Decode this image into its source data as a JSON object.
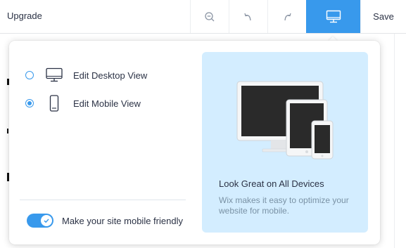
{
  "topbar": {
    "upgrade_label": "Upgrade",
    "zoom_out_icon": "zoom-out-icon",
    "undo_icon": "undo-icon",
    "redo_icon": "redo-icon",
    "device_icon": "desktop-icon",
    "save_label": "Save",
    "accent_color": "#3899ec"
  },
  "popover": {
    "options": [
      {
        "label": "Edit Desktop View",
        "icon": "desktop-icon",
        "selected": false
      },
      {
        "label": "Edit Mobile View",
        "icon": "mobile-icon",
        "selected": true
      }
    ],
    "toggle": {
      "label": "Make your site mobile friendly",
      "on": true
    },
    "panel": {
      "title": "Look Great on All Devices",
      "description": "Wix makes it easy to optimize your website for mobile.",
      "background_color": "#d3edff"
    }
  }
}
